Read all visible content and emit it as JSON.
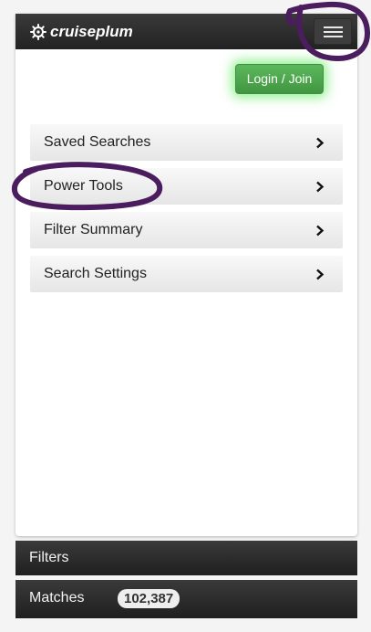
{
  "header": {
    "brand_name": "cruiseplum",
    "logo_icon": "ship-wheel-icon",
    "menu_icon": "hamburger-menu-icon",
    "background": "#2b2b2b"
  },
  "account": {
    "login_label": "Login / Join",
    "accent": "#5cb85c"
  },
  "menu": {
    "items": [
      {
        "label": "Saved Searches",
        "icon": "chevron-right-icon"
      },
      {
        "label": "Power Tools",
        "icon": "chevron-right-icon"
      },
      {
        "label": "Filter Summary",
        "icon": "chevron-right-icon"
      },
      {
        "label": "Search Settings",
        "icon": "chevron-right-icon"
      }
    ]
  },
  "footer": {
    "filters_label": "Filters",
    "matches_label": "Matches",
    "matches_count": "102,387"
  },
  "annotations": {
    "color": "#4b1d5e",
    "marked": [
      "hamburger-menu-button",
      "menu-item-power-tools"
    ]
  }
}
